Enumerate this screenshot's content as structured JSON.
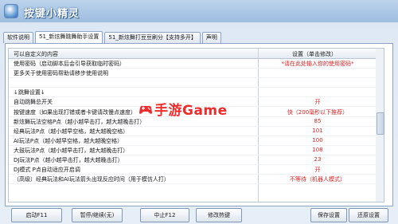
{
  "app": {
    "title": "按键小精灵"
  },
  "tabs": [
    {
      "label": "软件说明"
    },
    {
      "label": "51_新炫舞跳舞助手设置"
    },
    {
      "label": "51_新炫舞打豆豆刷分【支持多开】"
    },
    {
      "label": "声明"
    }
  ],
  "active_tab": 1,
  "grid": {
    "columns": [
      "可以自定义的内容",
      "设置（单击修改）"
    ],
    "rows": [
      {
        "key": "使用密码（启动脚本后会引导获取临时密码）",
        "value": "*请在此处输入你的使用密码*"
      },
      {
        "key": "更多关于使用密码帮助请移步使用说明",
        "value": ""
      },
      {
        "key": "",
        "value": ""
      },
      {
        "key": "↓跳舞设置↓",
        "value": ""
      },
      {
        "key": "自动跳舞总开关",
        "value": "开"
      },
      {
        "key": "按键速度（如果出现打错或者卡键请改慢点速度）",
        "value": "快（200毫秒以下推荐）"
      },
      {
        "key": "新炫舞玩法空格P点（越小越早击打，越大越晚击打）",
        "value": "85"
      },
      {
        "key": "经典玩法P点（越小越早空格，越大越晚空格）",
        "value": "101"
      },
      {
        "key": "AI玩法P点（越小越早空格，越大越晚空格）",
        "value": "100"
      },
      {
        "key": "大鼓玩法P点（越小越早击打，越大越晚击打）",
        "value": "108"
      },
      {
        "key": "DJ玩法P点（越小越早击打，越大越晚击打）",
        "value": "23"
      },
      {
        "key": "DJ模式 P点自动适应开启调",
        "value": "开"
      },
      {
        "key": "（高级）经典玩法和AI玩法箭头出现反应时间（用于模仿人打）",
        "value": "不等待（机器人模式）"
      }
    ]
  },
  "watermark": {
    "text": "手游Game"
  },
  "buttons": {
    "start": "启动F11",
    "pause": "暂停/继续(无)",
    "stop": "中止F12",
    "hotkey": "修改热键",
    "save": "保存设置",
    "restore": "还原设置"
  },
  "colors": {
    "value_text": "#e02424",
    "watermark": "#ef2b2b",
    "titlebar": "#9ebddf"
  }
}
